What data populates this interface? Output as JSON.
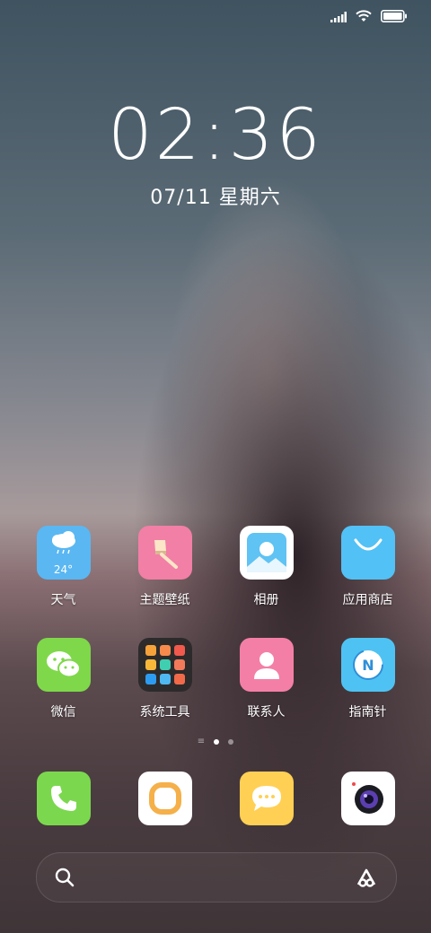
{
  "clock": {
    "time": "02:36",
    "date": "07/11 星期六"
  },
  "apps_row1": [
    {
      "label": "天气",
      "icon": "weather-icon",
      "temp": "24°"
    },
    {
      "label": "主题壁纸",
      "icon": "theme-brush-icon"
    },
    {
      "label": "相册",
      "icon": "gallery-icon"
    },
    {
      "label": "应用商店",
      "icon": "app-store-icon"
    }
  ],
  "apps_row2": [
    {
      "label": "微信",
      "icon": "wechat-icon"
    },
    {
      "label": "系统工具",
      "icon": "folder-icon"
    },
    {
      "label": "联系人",
      "icon": "contacts-icon"
    },
    {
      "label": "指南针",
      "icon": "compass-icon"
    }
  ],
  "dock": [
    {
      "icon": "phone-icon"
    },
    {
      "icon": "browser-icon"
    },
    {
      "icon": "messages-icon"
    },
    {
      "icon": "camera-icon"
    }
  ],
  "colors": {
    "weather": "#5ab7f2",
    "theme": "#f27fa5",
    "gallery": "#ffffff",
    "app_store": "#52c1f5",
    "wechat": "#7fd84a",
    "folder": "#2d2a2b",
    "contacts": "#f47fa6",
    "compass": "#4ec3f3",
    "phone": "#7bd84e",
    "browser": "#ffffff",
    "messages": "#ffd054",
    "camera": "#ffffff"
  }
}
